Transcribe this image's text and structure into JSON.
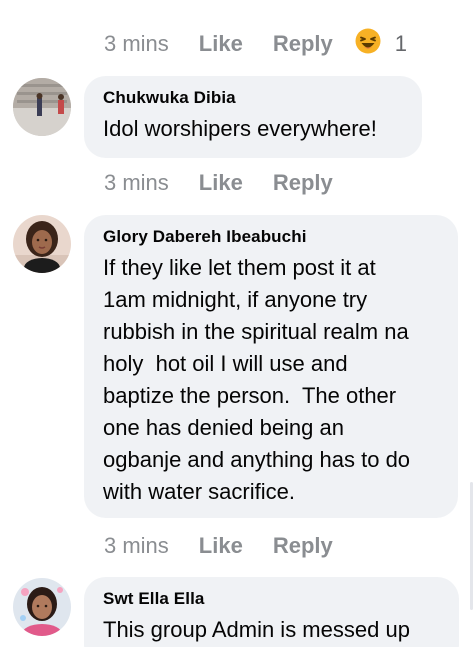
{
  "comments": [
    {
      "meta": {
        "time": "3 mins",
        "like": "Like",
        "reply": "Reply",
        "reaction_count": "1"
      }
    },
    {
      "author": "Chukwuka Dibia",
      "text": "Idol worshipers everywhere!",
      "meta": {
        "time": "3 mins",
        "like": "Like",
        "reply": "Reply"
      }
    },
    {
      "author": "Glory Dabereh Ibeabuchi",
      "text": "If they like let them post it at\n1am midnight, if anyone try\nrubbish in the spiritual realm na\nholy  hot oil I will use and\nbaptize the person.  The other\none has denied being an\nogbanje and anything has to do\nwith water sacrifice.",
      "meta": {
        "time": "3 mins",
        "like": "Like",
        "reply": "Reply"
      }
    },
    {
      "author": "Swt Ella Ella",
      "text": "This group Admin is messed up"
    }
  ],
  "icons": {
    "reaction": "haha-emoji-icon"
  },
  "colors": {
    "bubble": "#f0f2f5",
    "meta_text": "#8a8d91",
    "reaction_yellow": "#f7b125"
  }
}
